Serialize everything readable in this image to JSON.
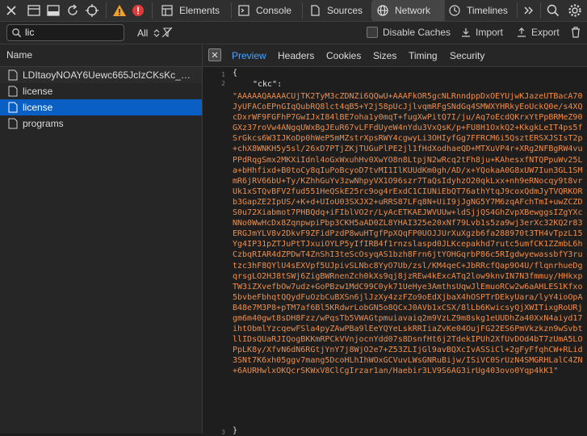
{
  "toolbar": {
    "tabs": [
      {
        "label": "Elements",
        "icon": "elements-icon"
      },
      {
        "label": "Console",
        "icon": "console-icon"
      },
      {
        "label": "Sources",
        "icon": "sources-icon"
      },
      {
        "label": "Network",
        "icon": "network-icon",
        "active": true
      },
      {
        "label": "Timelines",
        "icon": "timelines-icon"
      }
    ],
    "accent": "#f0a32a",
    "error_color": "#e03b3b"
  },
  "filter": {
    "value": "lic",
    "type_filter": "All",
    "disable_caches": "Disable Caches",
    "import_label": "Import",
    "export_label": "Export"
  },
  "requests": {
    "header": "Name",
    "rows": [
      {
        "name": "LDItaoyNOAY6Uewc665JcIzCKsKc_M9..."
      },
      {
        "name": "license"
      },
      {
        "name": "license",
        "selected": true
      },
      {
        "name": "programs"
      }
    ]
  },
  "details": {
    "tabs": [
      "Preview",
      "Headers",
      "Cookies",
      "Sizes",
      "Timing",
      "Security"
    ],
    "active_tab": "Preview",
    "line_numbers": [
      "1",
      "2",
      "3"
    ],
    "open_brace": "{",
    "key": "\"ckc\":",
    "value": "\"AAAAAQAAAACUjTK2TyM3cZDNZi6QQwU+AAAFkOR5gcNLRnndppDxOEYUjwKJazeUTBacA70JyUFACoEPnGIqQubRQ8lct4qB5+Y2j58pUcJjlvqmRFgSNdGq4SMWXYHRkyEoUckQ0e/s4XQcDxrWF9FGFhP7GwIJxI84lBE7oha1y0mqT+fugXwPitQ7I/ju/Aq7oEcdQKrxYtPpBRMeZ90GXz37roVw4ANgqUWxBgJEuR67vLFFdUyeW4nYdu3VxQsK/p+FU8H1OxkQ2+KkgkLeIT4ps5fSrGkcs6W3IJKoDp0hWeP5mMZstrXpsRWY4cgwyLi3OHIyfGg7FFRCM6i5QsztERSXJSIsT2p+chX8WNKH5y5sl/26xD7PTjZKjTUGuPlPE2jl1fHdXodhaeQD+MTXuVP4r+XRg2NFBgRW4vuPPdRqgSmx2MKXiIdnl4oGxWxuhHv0XwYO8n8LtpjN2wRcq2tFh8ju+KAhesxfNTQPpuWv25La+bHhfixd+B0toCy8qIuPoBcyoD7tvMI1IlKUUdKm0gh/AD/x+YQokaA0G8xUW7Iun3GL1SMmR6jRV66bU+Ty/KZhhGuYv3zwNhpyVX1O96szr7TaQsIdyhzO20qkLxx+nh9eRNocqy9t8vrUk1xSTQvBFV2fud551HeQSkE25rc9og4rExdC1CIUNiEbQT76athYtqJ9coxQdmJyTVQRKORb3GapZE2IpUS/+K+d+UIoU03SXJX2+uRRS87LFq8N+UiI9jJgNG5Y7M6zqAFchTmI+uwZCZDS0u72Xiabmot7PHBQdq+iFIblVO2r/LyAcETKAEJWVUUw+ldSjjQS4GhZvpXBewggsIZgYXcNNo0WwHcDx8ZqnpwpiPbp3CKH5aAD0ZL8YHAI325e20xNf79Lvb1s5za9wj3erXc32KQ2r83ERGJmYLV8v2DkvF9ZFidPzdP8wuHTgfPpXQqFP0UOJJUrXuXgzb6fa288970t3TH4vTpzL15Yg4IP31pZTJuPtTJxuiOYLP5yIfIRB4f1rnzslaspd0JLKcepakhd7rutc5umfCK1ZZmbL6hCzbqRIAR4dZPDwT4ZnShI3teScOsyqAS1bzh8Frn6jtYOHGqrbP86c5RIgdwyewassbfY3rutzc3hF8QYlU4sEXVpf5UJpivSLNbc8YyO7Ub/zsl/KM4qeC+JbRRcfQap9O4U/flqnrhueDgqrsgLO2HJ8tSWj6ZigBWRnenZch0kXs9qj8jzREw4kExcATq2low9knvIN7N3fmmuy/HHkxpTW3iZXvefbOw7udz+GoPBzw1MdC99C0yk71UeHye3AmthsUqwJlEmuoRCw2w6aAHLES1Kfxo5bvbeFbhqtQQydFuOzbCuBXSn6jlJzXy4zzFZo9oEdXjbaX4hOSPTrDEkyUara/lyY4ioOpAB48e7M3P8+pTM7af6Bl5KRdwrLobGN5o8QCxJ0AVb1xCSX/8lLb6KwicsyQjXWITixgRoURjgm6m40gwt8sDH8Fzz/wPqsTb5VWAGtpmuiavaiq2m9VzLZ9m8skg1eUUDhZa40XxN4aiyd17ihtObmlYzcqewFSla4pyZAwPBa9lEeYQYeLskRRIiaZvKe04OujFG22ES6PmVkzkzn9wSvbtllIDsQUaRJIQogBKKmRPCkVVnjocnYdd07s8DsnfHt6j2TdekIPUh2XfUvDOd4bT7zUmA5LOPpLK8y/XfvN6dN6RGtjYnY7j8WjO2e7+Z53ZLIjGl9avBQXcIvASSiCl+2gFyFfqhCW+RLid3SNt7K6xh05ggv7mang5DcoHLhIhWOxGCVuvLWsGNRuBijw/ISiVC0SrUzN4SMGRHLalC4ZN+6AURHwlxOKQcrSKWxV8ClCgIrzar1an/Haebir3LV9S6AG3irUg403ovo0Yqp4kK1\"",
    "close_brace": "}"
  }
}
